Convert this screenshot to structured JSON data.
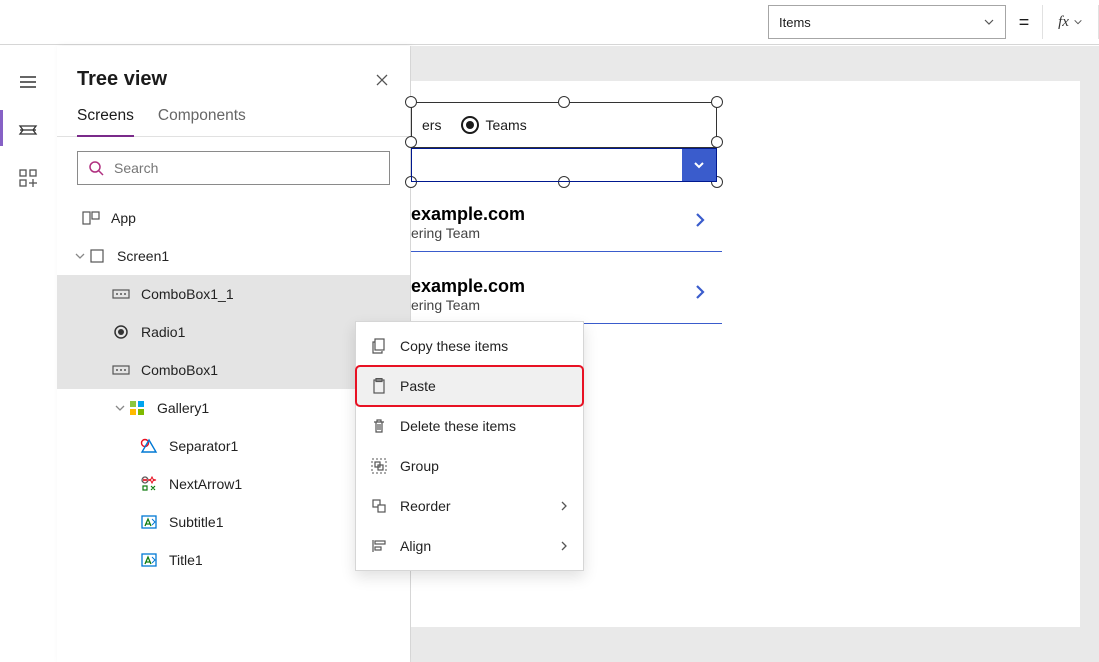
{
  "prop_selector": "Items",
  "tree": {
    "title": "Tree view",
    "tabs": {
      "screens": "Screens",
      "components": "Components"
    },
    "search_placeholder": "Search",
    "items": {
      "app": "App",
      "screen1": "Screen1",
      "combobox1_1": "ComboBox1_1",
      "radio1": "Radio1",
      "combobox1": "ComboBox1",
      "gallery1": "Gallery1",
      "separator1": "Separator1",
      "nextarrow1": "NextArrow1",
      "subtitle1": "Subtitle1",
      "title1": "Title1"
    }
  },
  "canvas": {
    "radio": {
      "opt1": "ers",
      "opt2": "Teams"
    },
    "list": [
      {
        "title": "example.com",
        "sub": "ering Team"
      },
      {
        "title": "example.com",
        "sub": "ering Team"
      }
    ]
  },
  "ctx": {
    "copy": "Copy these items",
    "paste": "Paste",
    "delete": "Delete these items",
    "group": "Group",
    "reorder": "Reorder",
    "align": "Align"
  }
}
